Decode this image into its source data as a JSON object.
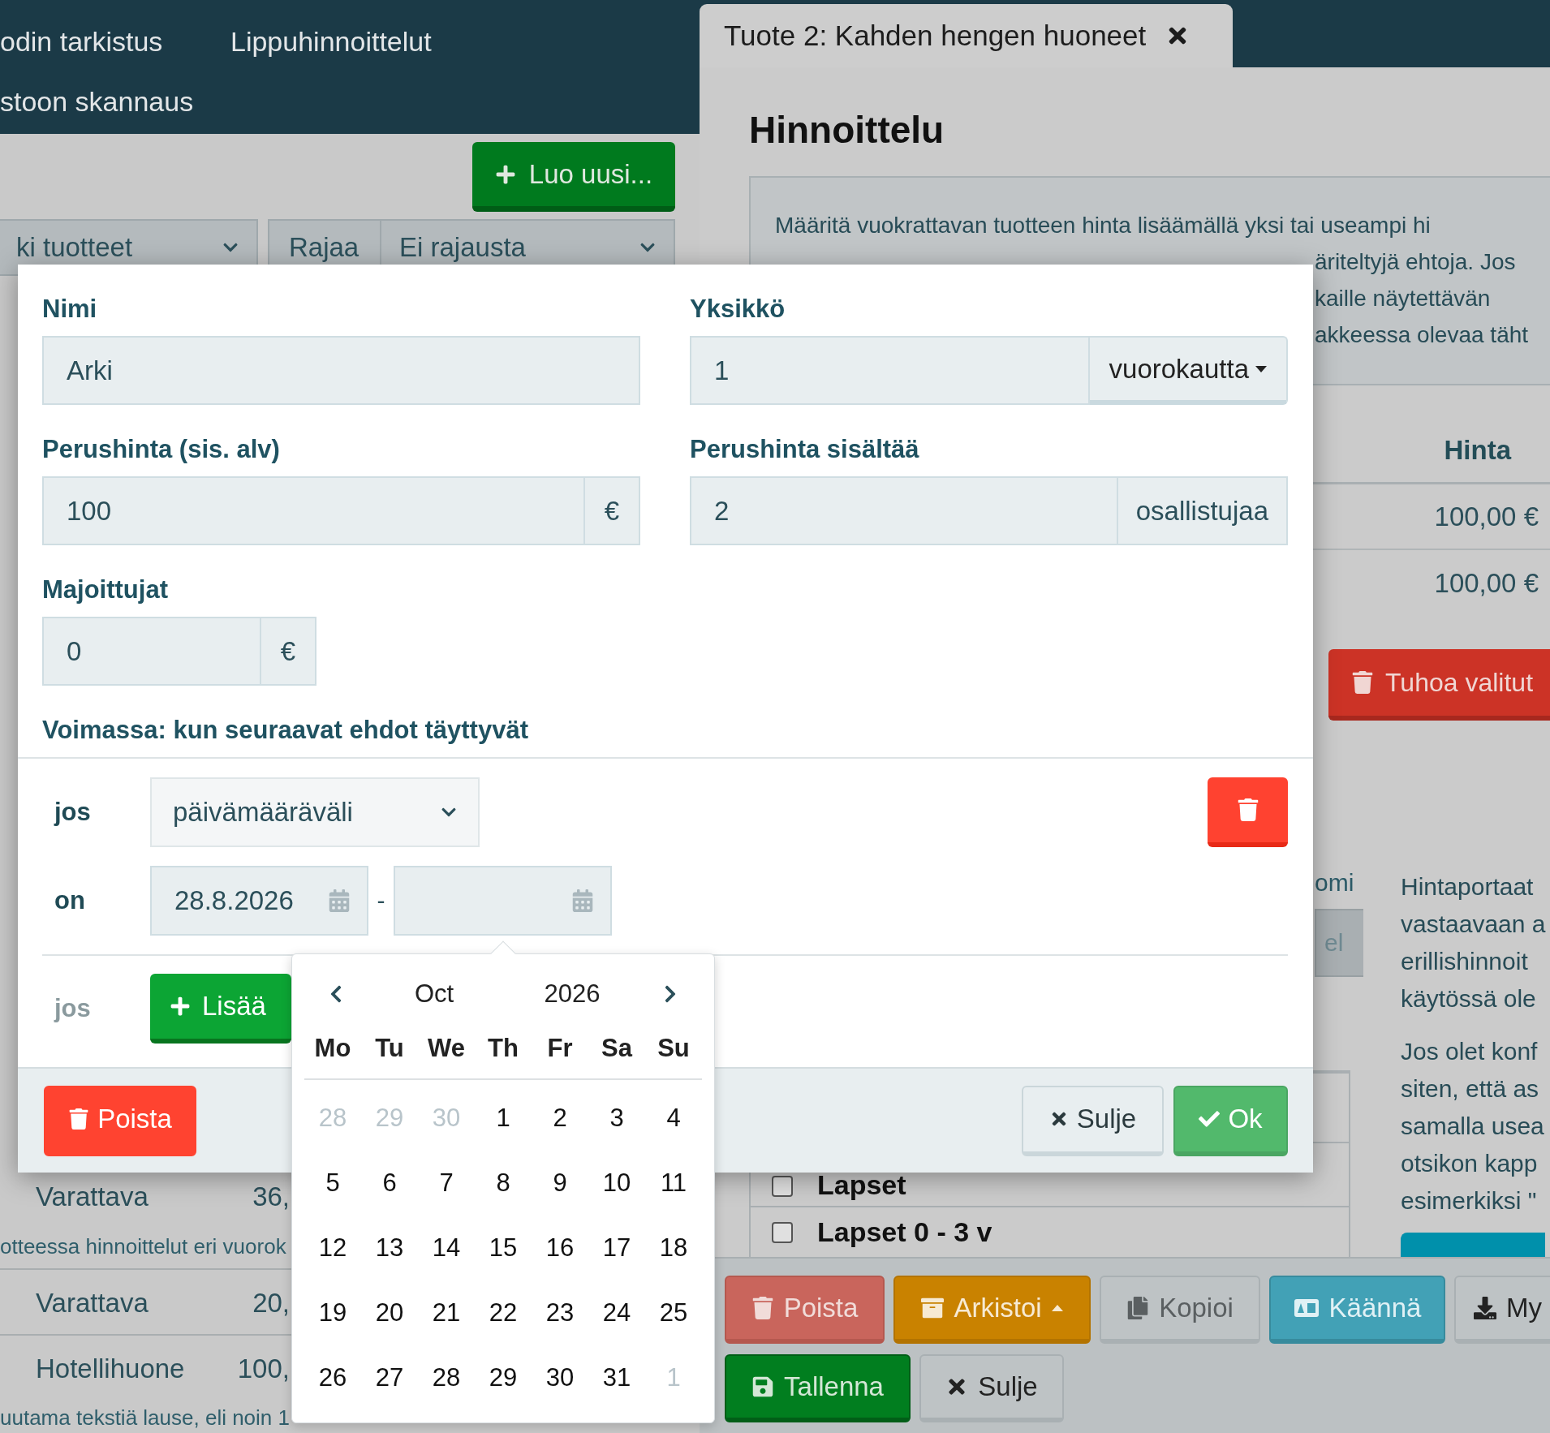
{
  "left_panel": {
    "nav": [
      {
        "label": "odin tarkistus"
      },
      {
        "label": "Lippuhinnoittelut"
      },
      {
        "label": "stoon skannaus"
      }
    ],
    "create_button": "Luo uusi...",
    "filters": {
      "product_select": "ki tuotteet",
      "filter_label": "Rajaa",
      "filter_select": "Ei rajausta"
    },
    "rows": [
      {
        "name": "Varattava",
        "price": "36,",
        "note": "otteessa hinnoittelut eri vuorok"
      },
      {
        "name": "Varattava",
        "price": "20,"
      },
      {
        "name": "Hotellihuone",
        "price": "100,",
        "note": "uutama tekstiä lause, eli noin 1"
      }
    ]
  },
  "product_tab": {
    "title": "Tuote 2: Kahden hengen huoneet"
  },
  "pricing": {
    "heading": "Hinnoittelu",
    "info_lines": [
      "Määritä vuokrattavan tuotteen hinta lisäämällä yksi tai useampi hi",
      "äriteltyjä ehtoja. Jos",
      "kaille näytettävän",
      "akkeessa olevaa täht"
    ],
    "table": {
      "columns": [
        "Hinta"
      ],
      "rows": [
        [
          "100,00 €"
        ],
        [
          "100,00 €"
        ]
      ]
    },
    "delete_selected_button": "Tuhoa valitut",
    "column_fragment": "omi",
    "field_fragment": "el",
    "participants": [
      {
        "label": "Lapset",
        "checked": false
      },
      {
        "label": "Lapset 0 - 3 v",
        "checked": false
      }
    ],
    "help_paragraphs": [
      [
        "Hintaportaat",
        "vastaavaan a",
        "erillishinnoit",
        "käytössä ole"
      ],
      [
        "Jos olet konf",
        "siten, että as",
        "samalla usea",
        "otsikon kapp",
        "esimerkiksi \""
      ]
    ]
  },
  "toolbar": [
    {
      "label": "Poista",
      "kind": "delete"
    },
    {
      "label": "Arkistoi",
      "kind": "archive"
    },
    {
      "label": "Kopioi",
      "kind": "copy"
    },
    {
      "label": "Käännä",
      "kind": "translate"
    },
    {
      "label": "My",
      "kind": "download"
    },
    {
      "label": "Tallenna",
      "kind": "save"
    },
    {
      "label": "Sulje",
      "kind": "close"
    }
  ],
  "price_dialog": {
    "name": {
      "label": "Nimi",
      "value": "Arki"
    },
    "unit": {
      "label": "Yksikkö",
      "value": "1",
      "unit": "vuorokautta"
    },
    "base_price": {
      "label": "Perushinta (sis. alv)",
      "value": "100",
      "suffix": "€"
    },
    "base_includes": {
      "label": "Perushinta sisältää",
      "value": "2",
      "suffix": "osallistujaa"
    },
    "lodgers": {
      "label": "Majoittujat",
      "value": "0",
      "suffix": "€"
    },
    "conditions_heading": "Voimassa: kun seuraavat ehdot täyttyvät",
    "condition": {
      "prefix": "jos",
      "type": "päivämääräväli",
      "operator": "on",
      "from": "28.8.2026",
      "separator": "-"
    },
    "add_row": {
      "prefix": "jos",
      "button": "Lisää"
    },
    "footer": {
      "delete": "Poista",
      "close": "Sulje",
      "ok": "Ok"
    }
  },
  "date_picker": {
    "month": "Oct",
    "year": "2026",
    "weekdays": [
      "Mo",
      "Tu",
      "We",
      "Th",
      "Fr",
      "Sa",
      "Su"
    ],
    "days": [
      {
        "label": "28",
        "outside": true
      },
      {
        "label": "29",
        "outside": true
      },
      {
        "label": "30",
        "outside": true
      },
      {
        "label": "1",
        "outside": false
      },
      {
        "label": "2",
        "outside": false
      },
      {
        "label": "3",
        "outside": false
      },
      {
        "label": "4",
        "outside": false
      },
      {
        "label": "5",
        "outside": false
      },
      {
        "label": "6",
        "outside": false
      },
      {
        "label": "7",
        "outside": false
      },
      {
        "label": "8",
        "outside": false
      },
      {
        "label": "9",
        "outside": false
      },
      {
        "label": "10",
        "outside": false
      },
      {
        "label": "11",
        "outside": false
      },
      {
        "label": "12",
        "outside": false
      },
      {
        "label": "13",
        "outside": false
      },
      {
        "label": "14",
        "outside": false
      },
      {
        "label": "15",
        "outside": false
      },
      {
        "label": "16",
        "outside": false
      },
      {
        "label": "17",
        "outside": false
      },
      {
        "label": "18",
        "outside": false
      },
      {
        "label": "19",
        "outside": false
      },
      {
        "label": "20",
        "outside": false
      },
      {
        "label": "21",
        "outside": false
      },
      {
        "label": "22",
        "outside": false
      },
      {
        "label": "23",
        "outside": false
      },
      {
        "label": "24",
        "outside": false
      },
      {
        "label": "25",
        "outside": false
      },
      {
        "label": "26",
        "outside": false
      },
      {
        "label": "27",
        "outside": false
      },
      {
        "label": "28",
        "outside": false
      },
      {
        "label": "29",
        "outside": false
      },
      {
        "label": "30",
        "outside": false
      },
      {
        "label": "31",
        "outside": false
      },
      {
        "label": "1",
        "outside": true
      }
    ]
  }
}
